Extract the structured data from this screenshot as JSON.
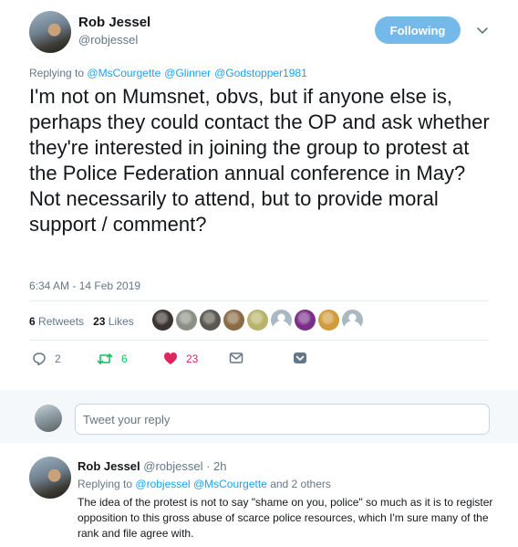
{
  "tweet": {
    "display_name": "Rob Jessel",
    "handle": "@robjessel",
    "follow_label": "Following",
    "replying_prefix": "Replying to",
    "replying_mentions": [
      "@MsCourgette",
      "@Glinner",
      "@Godstopper1981"
    ],
    "text": "I'm not on Mumsnet, obvs, but if anyone else is, perhaps they could contact the OP and ask whether they're interested in joining the group to protest at the Police Federation annual conference in May? Not necessarily to attend, but to provide moral support / comment?",
    "timestamp": "6:34 AM - 14 Feb 2019",
    "retweets_count": "6",
    "retweets_label": "Retweets",
    "likes_count": "23",
    "likes_label": "Likes",
    "actions": {
      "reply_count": "2",
      "retweet_count": "6",
      "like_count": "23"
    }
  },
  "likers": [
    {
      "icon": "liker-avatar",
      "color": "#3a3431"
    },
    {
      "icon": "liker-avatar",
      "color": "#8c8f86"
    },
    {
      "icon": "liker-avatar",
      "color": "#5a5750"
    },
    {
      "icon": "liker-avatar",
      "color": "#8a6b45"
    },
    {
      "icon": "liker-avatar",
      "color": "#b8b36a"
    },
    {
      "icon": "default-egg-avatar",
      "color": "#aab8c2"
    },
    {
      "icon": "liker-avatar",
      "color": "#7a2e87"
    },
    {
      "icon": "liker-avatar",
      "color": "#d19a3a"
    },
    {
      "icon": "default-egg-avatar",
      "color": "#aab8c2"
    }
  ],
  "reply_box": {
    "placeholder": "Tweet your reply"
  },
  "reply": {
    "display_name": "Rob Jessel",
    "handle_time": "@robjessel · 2h",
    "replying_prefix": "Replying to",
    "mention1": "@robjessel",
    "mention2": "@MsCourgette",
    "replying_suffix": "and 2 others",
    "text": "The idea of the protest is not to say \"shame on you, police\" so much as it is to register opposition to this gross abuse of scarce police resources, which I'm sure many of the rank and file agree with."
  },
  "colors": {
    "accent": "#1da1f2",
    "follow_bg": "#74b9ea",
    "retweet_green": "#17bf63",
    "like_red": "#e0245e",
    "muted": "#657786"
  }
}
